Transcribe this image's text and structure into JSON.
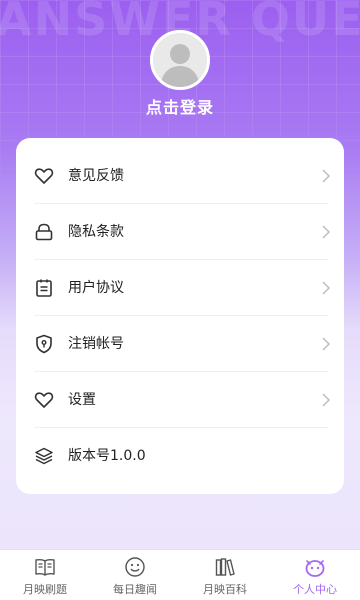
{
  "header": {
    "watermark": "ANSWER QUE",
    "login_label": "点击登录"
  },
  "menu": {
    "items": [
      {
        "label": "意见反馈",
        "icon": "heart-icon"
      },
      {
        "label": "隐私条款",
        "icon": "lock-icon"
      },
      {
        "label": "用户协议",
        "icon": "clipboard-icon"
      },
      {
        "label": "注销帐号",
        "icon": "shield-icon"
      },
      {
        "label": "设置",
        "icon": "heart-icon"
      },
      {
        "label": "版本号1.0.0",
        "icon": "layers-icon"
      }
    ]
  },
  "tabbar": {
    "tabs": [
      {
        "label": "月映刷题",
        "icon": "book-icon",
        "active": false
      },
      {
        "label": "每日趣闻",
        "icon": "smiley-icon",
        "active": false
      },
      {
        "label": "月映百科",
        "icon": "books-icon",
        "active": false
      },
      {
        "label": "个人中心",
        "icon": "profile-face-icon",
        "active": true
      }
    ]
  },
  "colors": {
    "accent": "#a468f2",
    "header_top": "#9c5ff0",
    "text": "#222222",
    "inactive_tab": "#666666"
  }
}
